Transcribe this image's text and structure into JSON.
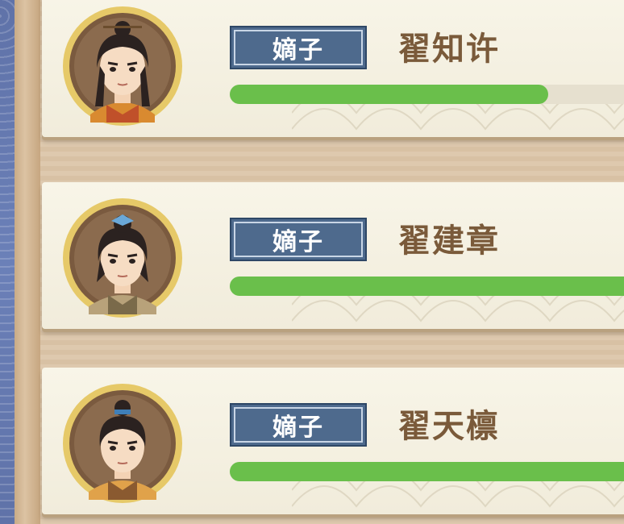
{
  "members": [
    {
      "rank": "嫡子",
      "name": "翟知许",
      "progress": 0.76,
      "avatar": "young-man-hairpin-portrait"
    },
    {
      "rank": "嫡子",
      "name": "翟建章",
      "progress": 1.0,
      "avatar": "young-man-blue-band-portrait"
    },
    {
      "rank": "嫡子",
      "name": "翟天檩",
      "progress": 1.0,
      "avatar": "young-man-blue-topknot-portrait"
    }
  ],
  "colors": {
    "tag_bg": "#4e6a8d",
    "name_text": "#7a5a3a",
    "bar_fill": "#6abf4b",
    "card_bg": "#f4f0e1"
  }
}
